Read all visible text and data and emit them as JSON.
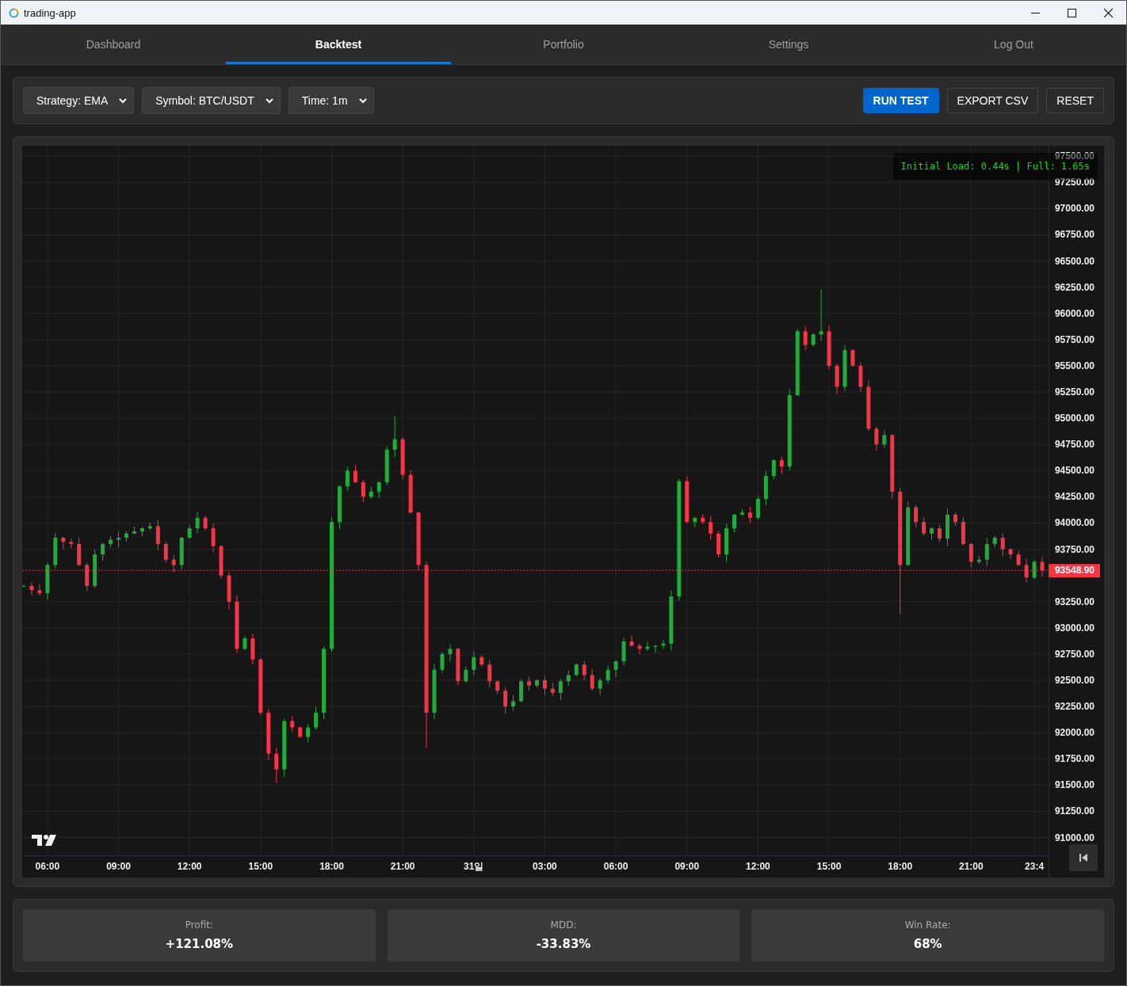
{
  "window": {
    "title": "trading-app"
  },
  "nav_tabs": [
    {
      "label": "Dashboard",
      "selected": false
    },
    {
      "label": "Backtest",
      "selected": true
    },
    {
      "label": "Portfolio",
      "selected": false
    },
    {
      "label": "Settings",
      "selected": false
    },
    {
      "label": "Log Out",
      "selected": false
    }
  ],
  "toolbar": {
    "dropdowns": [
      {
        "label": "Strategy: EMA"
      },
      {
        "label": "Symbol: BTC/USDT"
      },
      {
        "label": "Time: 1m"
      }
    ],
    "buttons": [
      {
        "label": "RUN TEST",
        "kind": "primary"
      },
      {
        "label": "EXPORT CSV",
        "kind": "secondary"
      },
      {
        "label": "RESET",
        "kind": "secondary"
      }
    ]
  },
  "chart": {
    "perf_overlay": "Initial Load: 0.44s | Full: 1.65s",
    "chart_data": {
      "type": "candlestick",
      "grid": true,
      "ylim": [
        90830,
        97600
      ],
      "categories": [
        null,
        null,
        null,
        "06:00",
        null,
        null,
        null,
        null,
        null,
        null,
        null,
        null,
        "09:00",
        null,
        null,
        null,
        null,
        null,
        null,
        null,
        null,
        "12:00",
        null,
        null,
        null,
        null,
        null,
        null,
        null,
        null,
        "15:00",
        null,
        null,
        null,
        null,
        null,
        null,
        null,
        null,
        "18:00",
        null,
        null,
        null,
        null,
        null,
        null,
        null,
        null,
        "21:00",
        null,
        null,
        null,
        null,
        null,
        null,
        null,
        null,
        "31일",
        null,
        null,
        null,
        null,
        null,
        null,
        null,
        null,
        "03:00",
        null,
        null,
        null,
        null,
        null,
        null,
        null,
        null,
        "06:00",
        null,
        null,
        null,
        null,
        null,
        null,
        null,
        null,
        "09:00",
        null,
        null,
        null,
        null,
        null,
        null,
        null,
        null,
        "12:00",
        null,
        null,
        null,
        null,
        null,
        null,
        null,
        null,
        "15:00",
        null,
        null,
        null,
        null,
        null,
        null,
        null,
        null,
        "18:00",
        null,
        null,
        null,
        null,
        null,
        null,
        null,
        null,
        "21:00",
        null,
        null,
        null,
        null,
        null,
        null,
        null,
        "23:4",
        null
      ],
      "ohlc": [
        [
          93400,
          93410,
          93390,
          93400
        ],
        [
          93400,
          93434,
          93310,
          93360
        ],
        [
          93360,
          93418,
          93310,
          93330
        ],
        [
          93330,
          93622,
          93270,
          93600
        ],
        [
          93600,
          93906,
          93570,
          93860
        ],
        [
          93860,
          93870,
          93750,
          93820
        ],
        [
          93820,
          93854,
          93760,
          93800
        ],
        [
          93800,
          93858,
          93590,
          93600
        ],
        [
          93600,
          93622,
          93350,
          93400
        ],
        [
          93400,
          93746,
          93380,
          93700
        ],
        [
          93700,
          93810,
          93640,
          93800
        ],
        [
          93800,
          93874,
          93770,
          93840
        ],
        [
          93840,
          93918,
          93770,
          93860
        ],
        [
          93860,
          93922,
          93820,
          93900
        ],
        [
          93900,
          93966,
          93890,
          93920
        ],
        [
          93920,
          93960,
          93870,
          93950
        ],
        [
          93950,
          94004,
          93930,
          93970
        ],
        [
          93970,
          94028,
          93740,
          93800
        ],
        [
          93800,
          93822,
          93620,
          93650
        ],
        [
          93650,
          93696,
          93530,
          93600
        ],
        [
          93600,
          93870,
          93560,
          93860
        ],
        [
          93860,
          93984,
          93850,
          93950
        ],
        [
          93950,
          94108,
          93900,
          94050
        ],
        [
          94050,
          94072,
          93930,
          93950
        ],
        [
          93950,
          93996,
          93720,
          93780
        ],
        [
          93780,
          93790,
          93470,
          93500
        ],
        [
          93500,
          93534,
          93180,
          93250
        ],
        [
          93250,
          93308,
          92760,
          92800
        ],
        [
          92800,
          92922,
          92790,
          92900
        ],
        [
          92900,
          92946,
          92650,
          92700
        ],
        [
          92700,
          92710,
          92170,
          92190
        ],
        [
          92190,
          92224,
          91740,
          91800
        ],
        [
          91800,
          91858,
          91520,
          91650
        ],
        [
          91650,
          92132,
          91580,
          92110
        ],
        [
          92110,
          92156,
          92010,
          92050
        ],
        [
          92050,
          92060,
          91950,
          91960
        ],
        [
          91960,
          92084,
          91910,
          92050
        ],
        [
          92050,
          92248,
          92030,
          92190
        ],
        [
          92190,
          92822,
          92130,
          92800
        ],
        [
          92800,
          94056,
          92770,
          94010
        ],
        [
          94010,
          94360,
          93940,
          94350
        ],
        [
          94350,
          94534,
          94310,
          94500
        ],
        [
          94500,
          94558,
          94380,
          94390
        ],
        [
          94390,
          94412,
          94200,
          94250
        ],
        [
          94250,
          94346,
          94230,
          94300
        ],
        [
          94300,
          94400,
          94240,
          94390
        ],
        [
          94390,
          94734,
          94360,
          94700
        ],
        [
          94700,
          95020,
          94630,
          94800
        ],
        [
          94800,
          94822,
          94420,
          94460
        ],
        [
          94460,
          94506,
          94090,
          94100
        ],
        [
          94100,
          94110,
          93550,
          93600
        ],
        [
          93600,
          93634,
          91850,
          92190
        ],
        [
          92190,
          92658,
          92130,
          92600
        ],
        [
          92600,
          92772,
          92570,
          92750
        ],
        [
          92750,
          92846,
          92680,
          92800
        ],
        [
          92800,
          92810,
          92450,
          92490
        ],
        [
          92490,
          92634,
          92480,
          92600
        ],
        [
          92600,
          92778,
          92550,
          92720
        ],
        [
          92720,
          92742,
          92630,
          92650
        ],
        [
          92650,
          92696,
          92430,
          92490
        ],
        [
          92490,
          92500,
          92370,
          92400
        ],
        [
          92400,
          92434,
          92180,
          92250
        ],
        [
          92250,
          92358,
          92210,
          92300
        ],
        [
          92300,
          92512,
          92290,
          92490
        ],
        [
          92490,
          92536,
          92400,
          92450
        ],
        [
          92450,
          92510,
          92430,
          92500
        ],
        [
          92500,
          92534,
          92360,
          92420
        ],
        [
          92420,
          92478,
          92350,
          92380
        ],
        [
          92380,
          92512,
          92310,
          92490
        ],
        [
          92490,
          92596,
          92450,
          92550
        ],
        [
          92550,
          92660,
          92540,
          92650
        ],
        [
          92650,
          92684,
          92500,
          92550
        ],
        [
          92550,
          92608,
          92400,
          92420
        ],
        [
          92420,
          92522,
          92360,
          92500
        ],
        [
          92500,
          92646,
          92470,
          92600
        ],
        [
          92600,
          92690,
          92530,
          92680
        ],
        [
          92680,
          92904,
          92640,
          92870
        ],
        [
          92870,
          92928,
          92820,
          92830
        ],
        [
          92830,
          92852,
          92750,
          92800
        ],
        [
          92800,
          92866,
          92780,
          92820
        ],
        [
          92820,
          92840,
          92760,
          92830
        ],
        [
          92830,
          92884,
          92800,
          92850
        ],
        [
          92850,
          93358,
          92780,
          93300
        ],
        [
          93300,
          94422,
          93260,
          94400
        ],
        [
          94400,
          94446,
          94000,
          94010
        ],
        [
          94010,
          94060,
          93960,
          94050
        ],
        [
          94050,
          94084,
          93990,
          94010
        ],
        [
          94010,
          94068,
          93840,
          93900
        ],
        [
          93900,
          93922,
          93670,
          93700
        ],
        [
          93700,
          93996,
          93630,
          93950
        ],
        [
          93950,
          94090,
          93910,
          94080
        ],
        [
          94080,
          94134,
          94070,
          94100
        ],
        [
          94100,
          94158,
          94000,
          94050
        ],
        [
          94050,
          94252,
          94030,
          94230
        ],
        [
          94230,
          94496,
          94170,
          94450
        ],
        [
          94450,
          94610,
          94420,
          94600
        ],
        [
          94600,
          94634,
          94470,
          94540
        ],
        [
          94540,
          95278,
          94500,
          95220
        ],
        [
          95220,
          95852,
          95210,
          95830
        ],
        [
          95830,
          95876,
          95650,
          95700
        ],
        [
          95700,
          95810,
          95680,
          95800
        ],
        [
          95800,
          96230,
          95740,
          95830
        ],
        [
          95830,
          95888,
          95470,
          95500
        ],
        [
          95500,
          95522,
          95230,
          95300
        ],
        [
          95300,
          95696,
          95260,
          95650
        ],
        [
          95650,
          95660,
          95490,
          95500
        ],
        [
          95500,
          95534,
          95250,
          95300
        ],
        [
          95300,
          95358,
          94880,
          94900
        ],
        [
          94900,
          94922,
          94690,
          94750
        ],
        [
          94750,
          94886,
          94720,
          94840
        ],
        [
          94840,
          94850,
          94230,
          94300
        ],
        [
          94300,
          94334,
          93130,
          93600
        ],
        [
          93600,
          94208,
          93590,
          94150
        ],
        [
          94150,
          94172,
          93960,
          94010
        ],
        [
          94010,
          94056,
          93880,
          93900
        ],
        [
          93900,
          93960,
          93840,
          93950
        ],
        [
          93950,
          93984,
          93820,
          93850
        ],
        [
          93850,
          94138,
          93780,
          94080
        ],
        [
          94080,
          94102,
          93970,
          94010
        ],
        [
          94010,
          94056,
          93790,
          93800
        ],
        [
          93800,
          93810,
          93580,
          93630
        ],
        [
          93630,
          93684,
          93610,
          93650
        ],
        [
          93650,
          93858,
          93590,
          93800
        ],
        [
          93800,
          93882,
          93770,
          93860
        ],
        [
          93860,
          93906,
          93680,
          93750
        ],
        [
          93750,
          93760,
          93660,
          93700
        ],
        [
          93700,
          93734,
          93590,
          93600
        ],
        [
          93600,
          93658,
          93430,
          93480
        ],
        [
          93480,
          93652,
          93460,
          93630
        ],
        [
          93630,
          93676,
          93489,
          93549
        ]
      ],
      "yticks": [
        {
          "value": 97500,
          "label": "97500.00"
        },
        {
          "value": 97250,
          "label": "97250.00"
        },
        {
          "value": 97000,
          "label": "97000.00"
        },
        {
          "value": 96750,
          "label": "96750.00"
        },
        {
          "value": 96500,
          "label": "96500.00"
        },
        {
          "value": 96250,
          "label": "96250.00"
        },
        {
          "value": 96000,
          "label": "96000.00"
        },
        {
          "value": 95750,
          "label": "95750.00"
        },
        {
          "value": 95500,
          "label": "95500.00"
        },
        {
          "value": 95250,
          "label": "95250.00"
        },
        {
          "value": 95000,
          "label": "95000.00"
        },
        {
          "value": 94750,
          "label": "94750.00"
        },
        {
          "value": 94500,
          "label": "94500.00"
        },
        {
          "value": 94250,
          "label": "94250.00"
        },
        {
          "value": 94000,
          "label": "94000.00"
        },
        {
          "value": 93750,
          "label": "93750.00"
        },
        {
          "value": 93250,
          "label": "93250.00"
        },
        {
          "value": 93000,
          "label": "93000.00"
        },
        {
          "value": 92750,
          "label": "92750.00"
        },
        {
          "value": 92500,
          "label": "92500.00"
        },
        {
          "value": 92250,
          "label": "92250.00"
        },
        {
          "value": 92000,
          "label": "92000.00"
        },
        {
          "value": 91750,
          "label": "91750.00"
        },
        {
          "value": 91500,
          "label": "91500.00"
        },
        {
          "value": 91250,
          "label": "91250.00"
        },
        {
          "value": 91000,
          "label": "91000.00"
        }
      ],
      "ref_lines": [
        {
          "axis": "y",
          "value": 93548.9,
          "label": "93548.90",
          "color": "#f23645"
        }
      ]
    }
  },
  "stats": [
    {
      "label": "Profit:",
      "value": "+121.08%"
    },
    {
      "label": "MDD:",
      "value": "-33.83%"
    },
    {
      "label": "Win Rate:",
      "value": "68%"
    }
  ]
}
